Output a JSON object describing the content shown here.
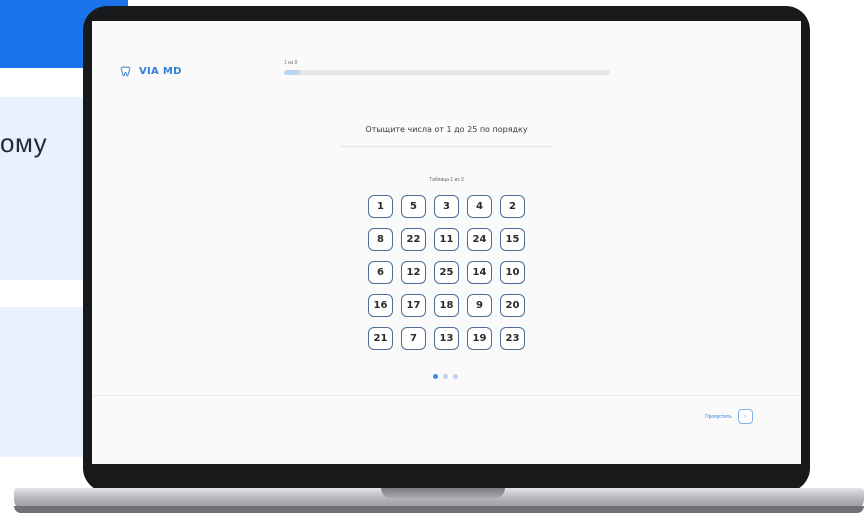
{
  "background": {
    "card_text": "ому"
  },
  "app": {
    "brand": "VIA MD",
    "brand_color": "#2f7fd8",
    "logo_icon": "tooth-icon"
  },
  "progress": {
    "label": "1 из 9",
    "current": 1,
    "total": 9,
    "fraction": 0.05
  },
  "task": {
    "instruction": "Отыщите числа от 1 до 25 по порядку",
    "table_label": "Таблица 1 из 3",
    "grid": [
      [
        "1",
        "5",
        "3",
        "4",
        "2"
      ],
      [
        "8",
        "22",
        "11",
        "24",
        "15"
      ],
      [
        "6",
        "12",
        "25",
        "14",
        "10"
      ],
      [
        "16",
        "17",
        "18",
        "9",
        "20"
      ],
      [
        "21",
        "7",
        "13",
        "19",
        "23"
      ]
    ]
  },
  "pagination": {
    "count": 3,
    "active_index": 0
  },
  "footer": {
    "skip_label": "Пропустить",
    "skip_icon": "arrow-right-icon"
  },
  "colors": {
    "accent": "#1a73e8",
    "cell_border": "#4c6e96",
    "dot_active": "#3a8ee6",
    "dot_inactive": "#bcd4ee"
  }
}
